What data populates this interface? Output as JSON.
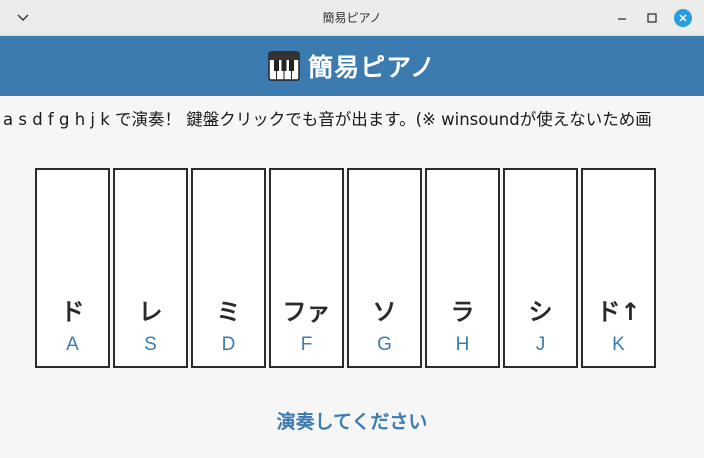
{
  "window": {
    "title": "簡易ピアノ",
    "accent": "#3b7bb0"
  },
  "header": {
    "title": "簡易ピアノ",
    "icon": "piano-icon"
  },
  "instructions": "a s d f g h j k で演奏！ 鍵盤クリックでも音が出ます。(※ winsoundが使えないため画",
  "keys": [
    {
      "note": "ド",
      "letter": "A"
    },
    {
      "note": "レ",
      "letter": "S"
    },
    {
      "note": "ミ",
      "letter": "D"
    },
    {
      "note": "ファ",
      "letter": "F"
    },
    {
      "note": "ソ",
      "letter": "G"
    },
    {
      "note": "ラ",
      "letter": "H"
    },
    {
      "note": "シ",
      "letter": "J"
    },
    {
      "note": "ド↑",
      "letter": "K"
    }
  ],
  "status": "演奏してください"
}
